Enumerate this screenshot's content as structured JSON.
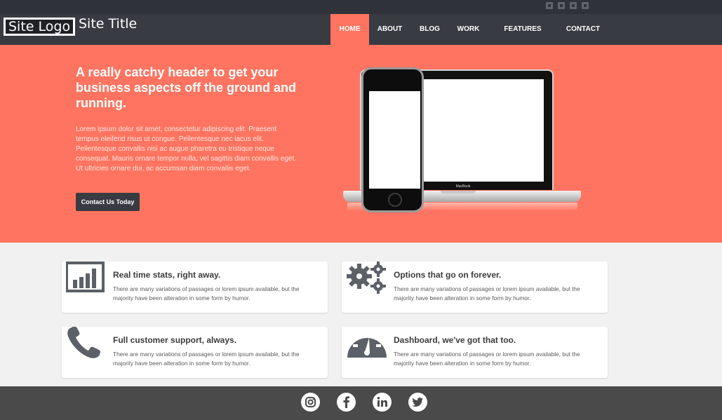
{
  "header": {
    "logo": "Site Logo",
    "site_title": "Site Title",
    "nav": [
      {
        "label": "HOME",
        "active": true
      },
      {
        "label": "ABOUT",
        "active": false
      },
      {
        "label": "BLOG",
        "active": false
      },
      {
        "label": "WORK",
        "active": false
      },
      {
        "label": "FEATURES",
        "active": false
      },
      {
        "label": "CONTACT",
        "active": false
      }
    ]
  },
  "topbar_icons": [
    "google-plus-icon",
    "linkedin-icon",
    "facebook-icon",
    "youtube-icon"
  ],
  "hero": {
    "title": "A really catchy header to get your business aspects off the ground and running.",
    "text": "Lorem ipsum dolor sit amet, consectetur adipiscing elit. Praesent tempus eleifend risus ut congue. Pellentesque nec lacus elit. Pellentesque convallis nisi ac augue pharetra eu tristique neque consequat. Mauris ornare tempor nulla, vel sagittis diam convallis eget. Ut ultricies ornare dui, ac accumsan diam convallis eget.",
    "button": "Contact Us Today",
    "laptop_label": "MacBook"
  },
  "features": [
    {
      "icon": "bar-chart-icon",
      "title": "Real time stats, right away.",
      "text": "There are many variations of passages or lorem ipsum available, but the majority have been alteration in some form by humor."
    },
    {
      "icon": "gears-icon",
      "title": "Options that go on forever.",
      "text": "There are many variations of passages or lorem ipsum available, but the majority have been alteration in some form by humor."
    },
    {
      "icon": "phone-icon",
      "title": "Full customer support, always.",
      "text": "There are many variations of passages or lorem ipsum available, but the majority have been alteration in some form by humor."
    },
    {
      "icon": "dashboard-icon",
      "title": "Dashboard, we've got that too.",
      "text": "There are many variations of passages or lorem ipsum available, but the majority have been alteration in some form by humor."
    }
  ],
  "footer": {
    "social": [
      "instagram-icon",
      "facebook-icon",
      "linkedin-icon",
      "twitter-icon"
    ]
  },
  "colors": {
    "accent": "#ff7460",
    "header": "#383b42",
    "footer": "#4a4a4a",
    "icon_gray": "#5c6068"
  }
}
